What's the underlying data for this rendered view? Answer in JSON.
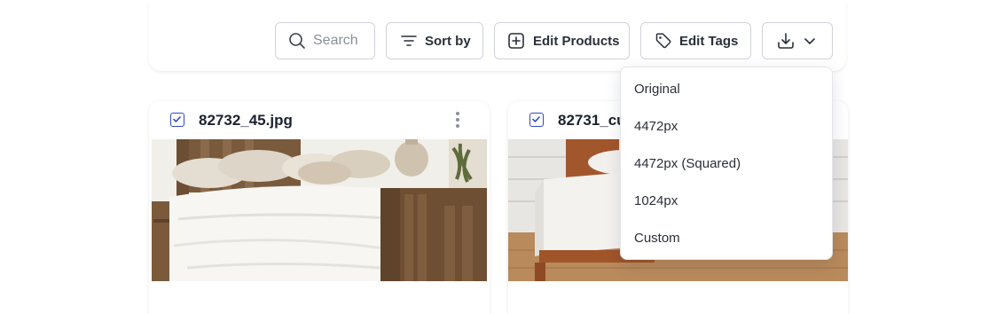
{
  "toolbar": {
    "search_placeholder": "Search",
    "sort_label": "Sort by",
    "edit_products_label": "Edit Products",
    "edit_tags_label": "Edit Tags",
    "download_icon": "download-icon",
    "chevron_icon": "chevron-down-icon"
  },
  "cards": [
    {
      "filename": "82732_45.jpg",
      "checked": true
    },
    {
      "filename": "82731_cu",
      "checked": true
    }
  ],
  "download_menu": {
    "items": [
      "Original",
      "4472px",
      "4472px (Squared)",
      "1024px",
      "Custom"
    ]
  },
  "colors": {
    "accent": "#2f49c9",
    "border": "#cfd3da",
    "text": "#2a2f3a"
  }
}
